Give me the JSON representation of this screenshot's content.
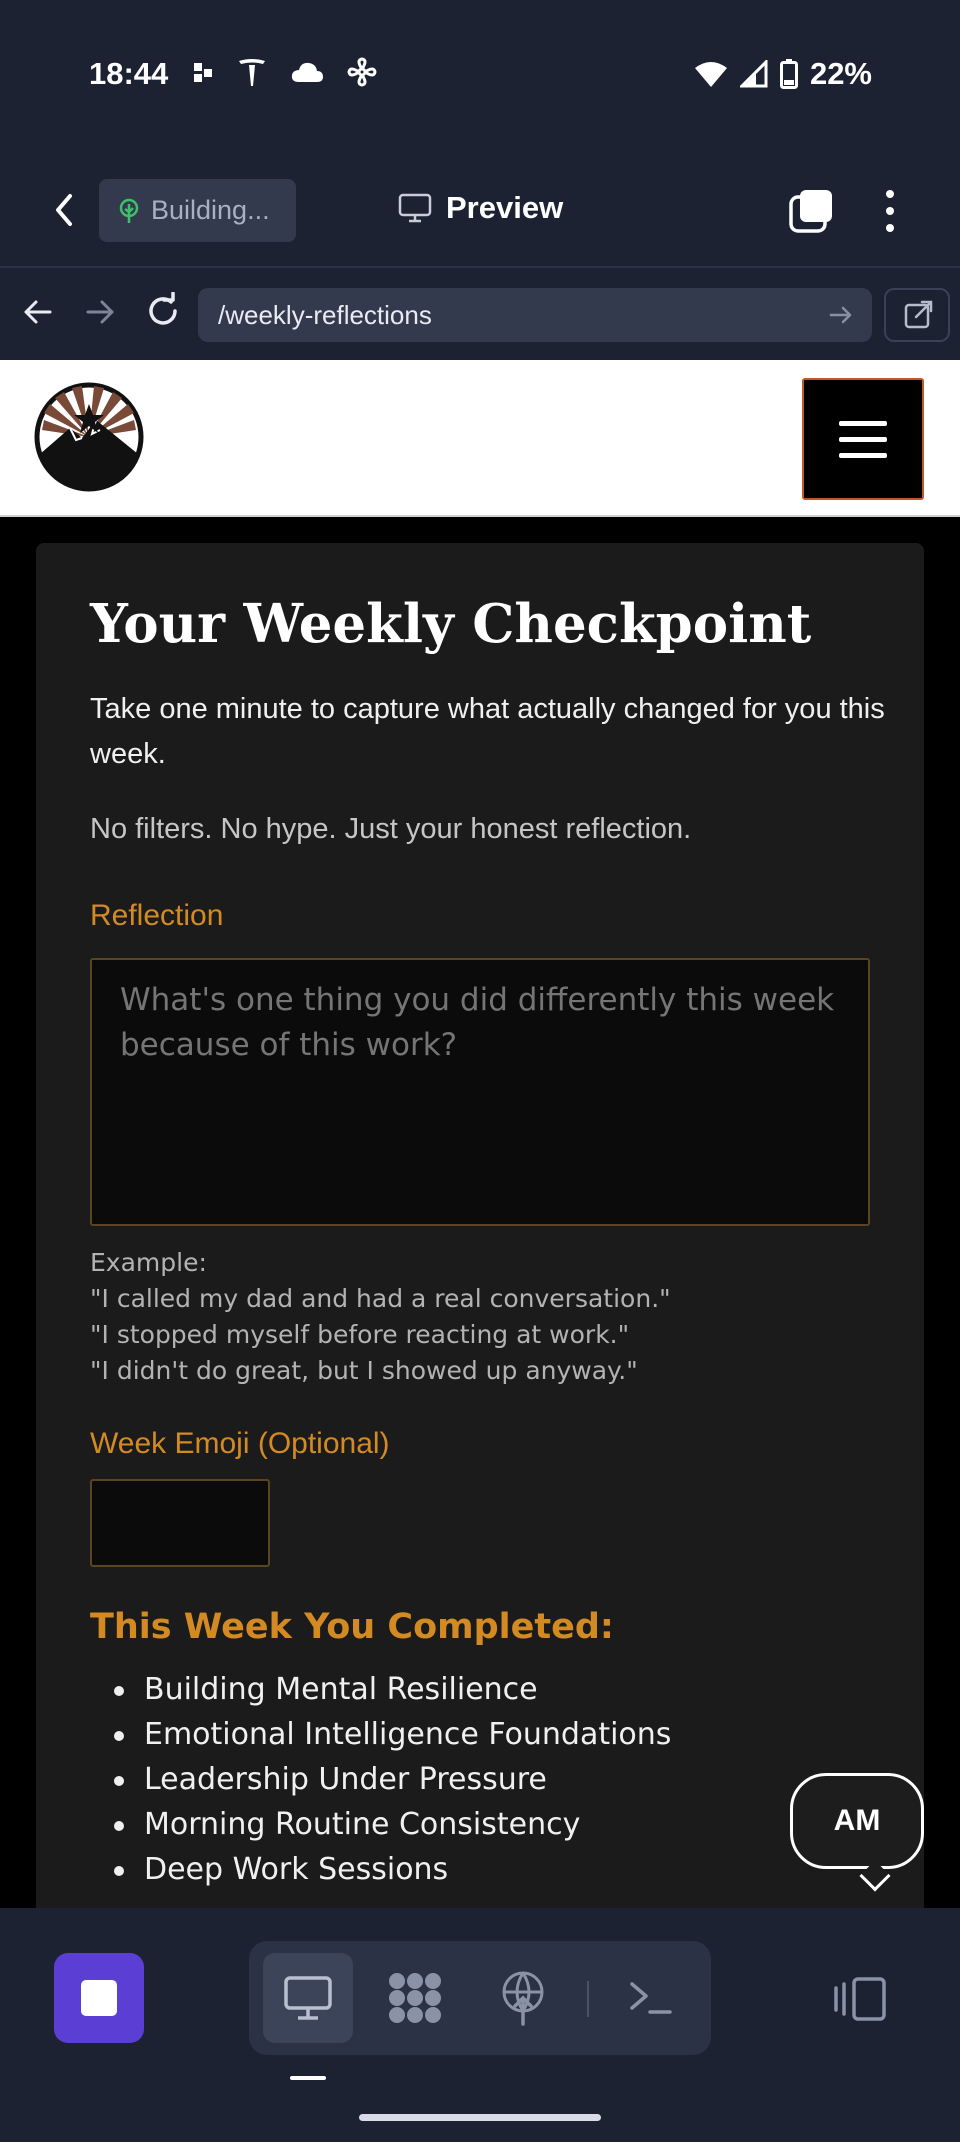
{
  "status_bar": {
    "time": "18:44",
    "battery": "22%",
    "icons": [
      "notification-dots-icon",
      "tesla-icon",
      "cloud-icon",
      "pinwheel-icon",
      "wifi-icon",
      "signal-icon",
      "battery-icon"
    ]
  },
  "app_bar": {
    "building_label": "Building...",
    "preview_label": "Preview"
  },
  "url_bar": {
    "url": "/weekly-reflections"
  },
  "page": {
    "title": "Your Weekly Checkpoint",
    "subtitle": "Take one minute to capture what actually changed for you this week.",
    "note": "No filters. No hype. Just your honest reflection.",
    "reflection_label": "Reflection",
    "reflection_placeholder": "What's one thing you did differently this week because of this work?",
    "example_lines": [
      "Example:",
      "\"I called my dad and had a real conversation.\"",
      "\"I stopped myself before reacting at work.\"",
      "\"I didn't do great, but I showed up anyway.\""
    ],
    "emoji_label": "Week Emoji (Optional)",
    "completed_title": "This Week You Completed:",
    "completed_items": [
      "Building Mental Resilience",
      "Emotional Intelligence Foundations",
      "Leadership Under Pressure",
      "Morning Routine Consistency",
      "Deep Work Sessions"
    ],
    "avatar_initials": "AM"
  },
  "colors": {
    "accent_orange": "#d48a22",
    "stop_purple": "#5b3fd4",
    "app_bg": "#1d2232",
    "card_bg": "#1b1b1b"
  }
}
